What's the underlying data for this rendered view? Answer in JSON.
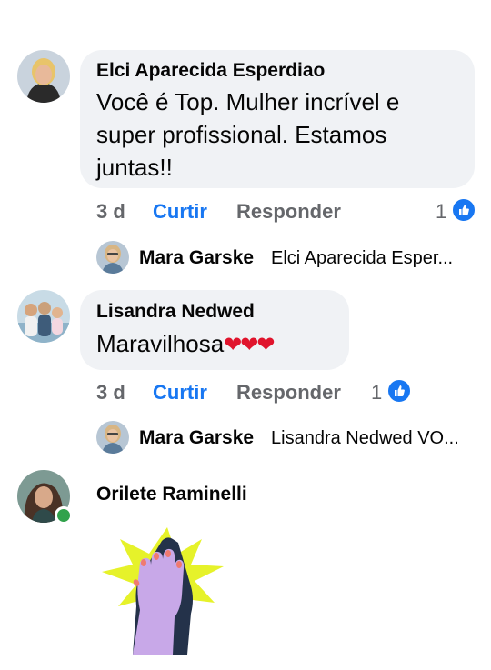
{
  "comments": [
    {
      "author": "Elci Aparecida Esperdiao",
      "lines": [
        "Você é Top. Mulher incrível e",
        "super profissional. Estamos",
        "juntas!!"
      ],
      "time": "3 d",
      "like_label": "Curtir",
      "reply_label": "Responder",
      "reaction_count": "1",
      "reply": {
        "author": "Mara Garske",
        "preview": "Elci Aparecida Esper..."
      }
    },
    {
      "author": "Lisandra Nedwed",
      "text": "Maravilhosa",
      "hearts": "❤❤❤",
      "time": "3 d",
      "like_label": "Curtir",
      "reply_label": "Responder",
      "reaction_count": "1",
      "reply": {
        "author": "Mara Garske",
        "preview": "Lisandra Nedwed VO..."
      }
    },
    {
      "author": "Orilete Raminelli",
      "sticker": "high-five-sticker"
    }
  ],
  "colors": {
    "bubble": "#f0f2f5",
    "link_blue": "#1877f2",
    "meta_gray": "#65676b",
    "online_green": "#31a24c"
  }
}
